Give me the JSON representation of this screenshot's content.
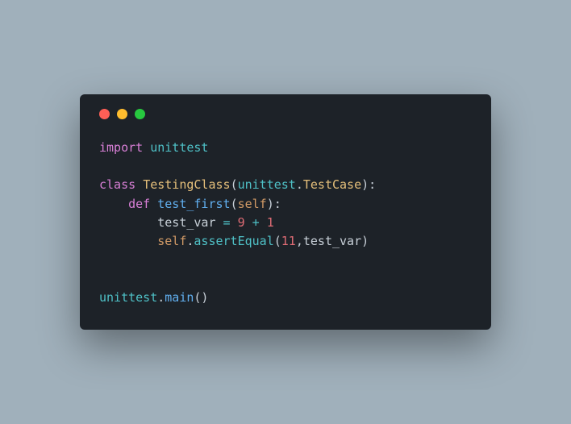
{
  "titlebar": {
    "close": "red",
    "minimize": "yellow",
    "zoom": "green"
  },
  "code": {
    "l1": {
      "kw": "import",
      "mod": "unittest"
    },
    "l3": {
      "kw": "class",
      "cls": "TestingClass",
      "punc1": "(",
      "mod": "unittest",
      "dot": ".",
      "cls2": "TestCase",
      "punc2": "):"
    },
    "l4": {
      "indent": "    ",
      "kw": "def",
      "fn": "test_first",
      "p1": "(",
      "self": "self",
      "p2": "):"
    },
    "l5": {
      "indent": "        ",
      "var": "test_var ",
      "op": "= ",
      "n1": "9",
      "plus": " + ",
      "n2": "1"
    },
    "l6": {
      "indent": "        ",
      "self": "self",
      "dot": ".",
      "method": "assertEqual",
      "p1": "(",
      "n": "11",
      "comma": ",",
      "var": "test_var",
      "p2": ")"
    },
    "l9": {
      "mod": "unittest",
      "dot": ".",
      "fn": "main",
      "p": "()"
    }
  }
}
